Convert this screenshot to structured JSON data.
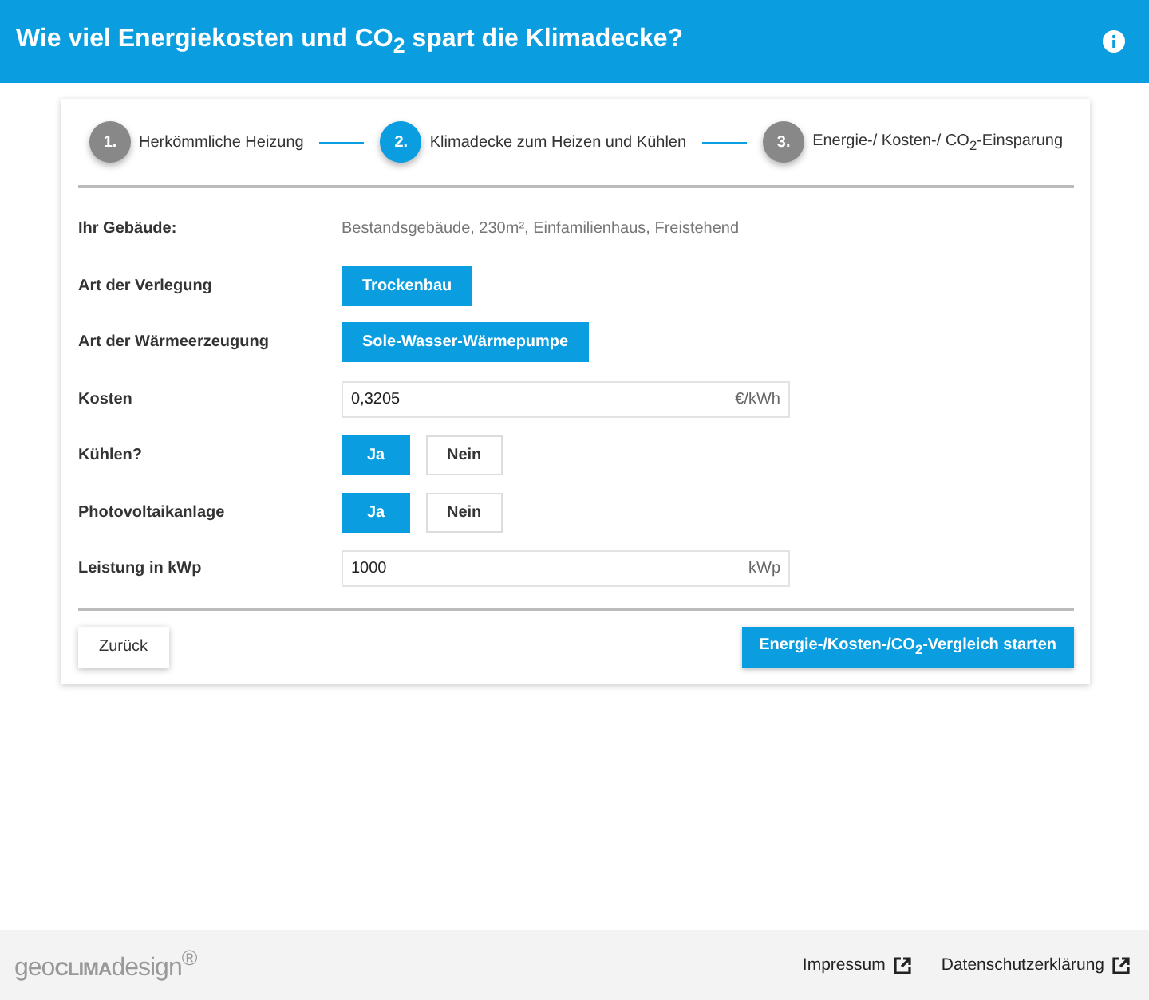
{
  "header": {
    "title": "Wie viel Energiekosten und CO$_{2}$ spart die Klimadecke?"
  },
  "steps": [
    {
      "number": "1.",
      "label": "Herkömmliche Heizung",
      "selected": false
    },
    {
      "number": "2.",
      "label": "Klimadecke zum Heizen und Kühlen",
      "selected": true
    },
    {
      "number": "3.",
      "label": "Energie-/ Kosten-/ CO$_{2}$-Einsparung",
      "selected": false
    }
  ],
  "rows": [
    {
      "label": "Ihr Gebäude:",
      "kind": "text",
      "value": "Bestandsgebäude, 230m², Einfamilienhaus, Freistehend"
    },
    {
      "label": "Art der Verlegung",
      "kind": "choice",
      "options": [
        {
          "label": "Trockenbau",
          "selected": true
        }
      ]
    },
    {
      "label": "Art der Wärmeerzeugung",
      "kind": "choice",
      "options": [
        {
          "label": "Sole-Wasser-Wärmepumpe",
          "selected": true
        }
      ]
    },
    {
      "label": "Kosten",
      "kind": "input",
      "value": "0,3205",
      "unit": "€/kWh"
    },
    {
      "label": "Kühlen?",
      "kind": "choice",
      "options": [
        {
          "label": "Ja",
          "selected": true
        },
        {
          "label": "Nein",
          "selected": false
        }
      ]
    },
    {
      "label": "Photovoltaikanlage",
      "kind": "choice",
      "options": [
        {
          "label": "Ja",
          "selected": true
        },
        {
          "label": "Nein",
          "selected": false
        }
      ]
    },
    {
      "label": "Leistung in kWp",
      "kind": "input",
      "value": "1000",
      "unit": "kWp"
    }
  ],
  "actions": {
    "back": "Zurück",
    "start": "Energie-/Kosten-/CO$_{2}$-Vergleich starten"
  },
  "footer": {
    "logo": "geo**CLIMA**design$^{®}$",
    "links": [
      "Impressum",
      "Datenschutzerklärung"
    ]
  }
}
